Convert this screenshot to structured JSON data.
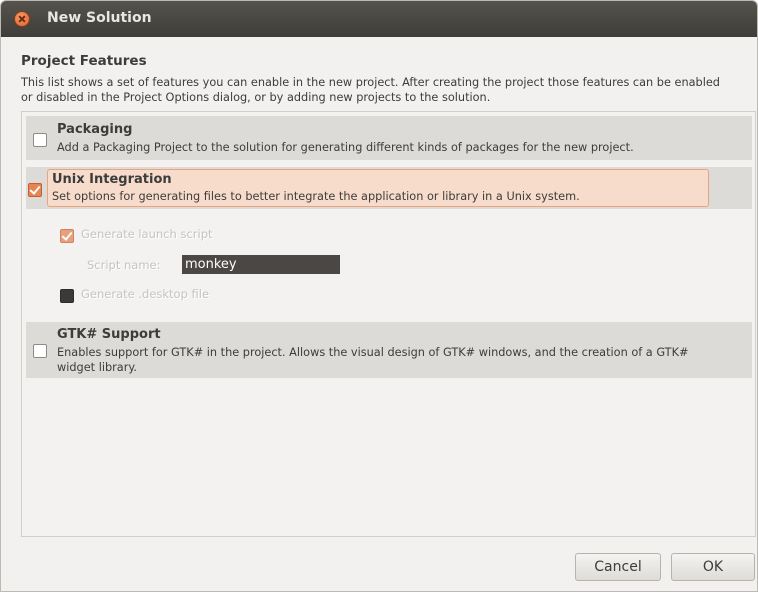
{
  "window": {
    "title": "New Solution"
  },
  "section": {
    "title": "Project Features",
    "description": "This list shows a set of features you can enable in the new project. After creating the project those features can be enabled or disabled in the Project Options dialog, or by adding new projects to the solution."
  },
  "features": [
    {
      "title": "Packaging",
      "description": "Add a Packaging Project to the solution for generating different kinds of packages for the new project.",
      "checked": false
    },
    {
      "title": "Unix Integration",
      "description": "Set options for generating files to better integrate the application or library in a Unix system.",
      "checked": true
    },
    {
      "title": "GTK# Support",
      "description": "Enables support for GTK# in the project. Allows the visual design of GTK# windows, and the creation of a GTK# widget library.",
      "checked": false
    }
  ],
  "unix_options": {
    "generate_launch_script": "Generate launch script",
    "generate_launch_script_checked": true,
    "script_name_label": "Script name:",
    "script_name_value": "monkey",
    "generate_desktop_file": "Generate .desktop file",
    "generate_desktop_file_checked": false
  },
  "buttons": {
    "cancel": "Cancel",
    "ok": "OK"
  },
  "colors": {
    "titlebar": "#3e3d39",
    "accent": "#e58556",
    "highlight": "#f8dccb"
  }
}
